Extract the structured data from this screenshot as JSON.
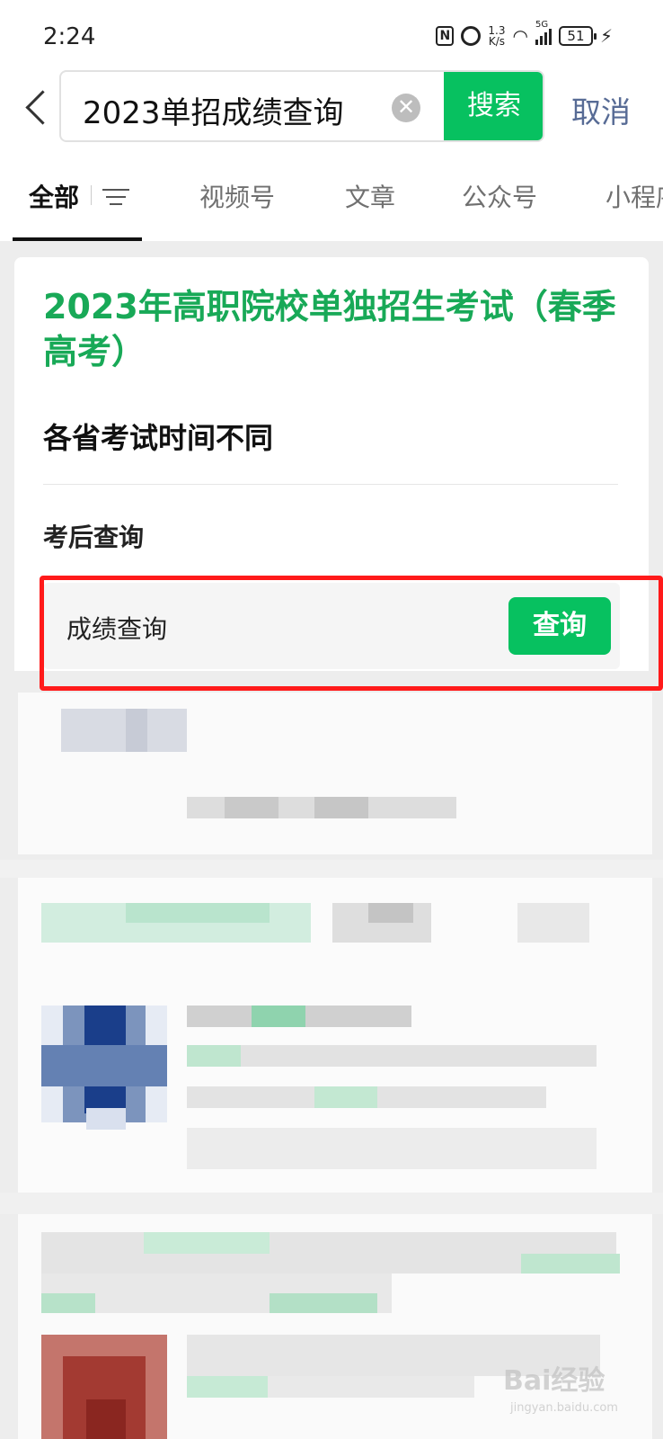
{
  "status_bar": {
    "time": "2:24",
    "net_speed_value": "1.3",
    "net_speed_unit": "K/s",
    "signal_type": "5G",
    "battery": "51"
  },
  "search": {
    "query": "2023单招成绩查询",
    "button_label": "搜索",
    "cancel_label": "取消"
  },
  "tabs": [
    {
      "label": "全部",
      "active": true
    },
    {
      "label": "视频号"
    },
    {
      "label": "文章"
    },
    {
      "label": "公众号"
    },
    {
      "label": "小程序"
    }
  ],
  "card": {
    "title": "2023年高职院校单独招生考试（春季高考）",
    "subtitle": "各省考试时间不同",
    "section_label": "考后查询",
    "query_row": {
      "label": "成绩查询",
      "button_label": "查询"
    }
  },
  "watermark": {
    "main": "Bai经验",
    "sub": "jingyan.baidu.com"
  },
  "colors": {
    "accent_green": "#07c160",
    "title_green": "#18a957",
    "link_blue": "#576b95",
    "highlight_red": "#ff1a1a"
  }
}
